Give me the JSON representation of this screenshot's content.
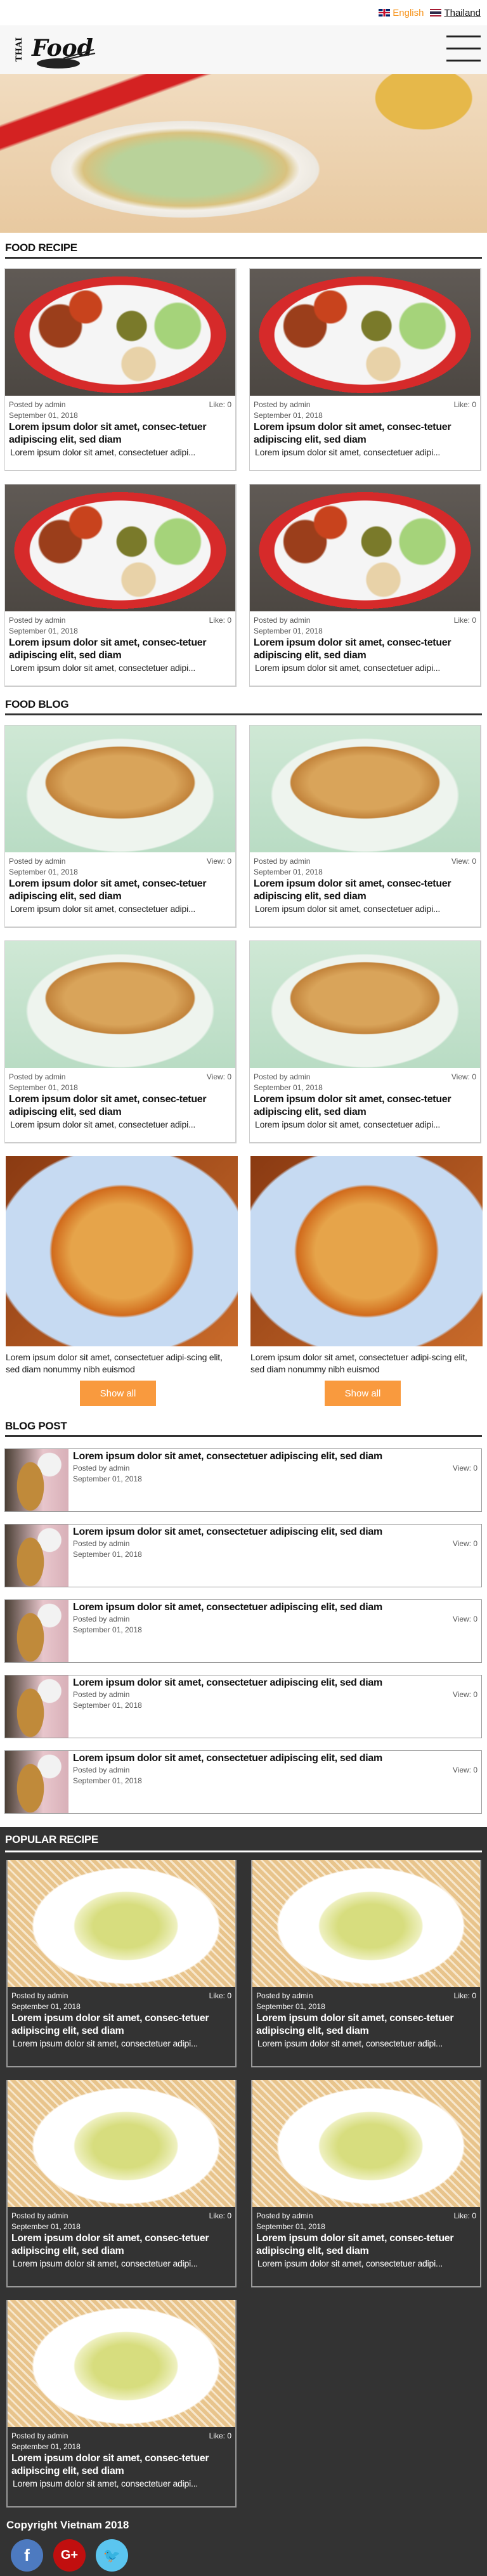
{
  "topbar": {
    "lang_en": "English",
    "lang_th": "Thailand",
    "accent": "#f7941d"
  },
  "header": {
    "logo_text": "Thai Food"
  },
  "sections": {
    "recipe": "FOOD RECIPE",
    "blog": "FOOD BLOG",
    "posts": "BLOG POST",
    "popular": "POPULAR RECIPE"
  },
  "recipes": [
    {
      "author": "Posted by admin",
      "stat": "Like: 0",
      "date": "September 01, 2018",
      "title": "Lorem ipsum dolor sit amet, consec-tetuer adipiscing elit, sed diam",
      "excerpt": "Lorem ipsum dolor sit amet, consectetuer adipi..."
    },
    {
      "author": "Posted by admin",
      "stat": "Like: 0",
      "date": "September 01, 2018",
      "title": "Lorem ipsum dolor sit amet, consec-tetuer adipiscing elit, sed diam",
      "excerpt": "Lorem ipsum dolor sit amet, consectetuer adipi..."
    },
    {
      "author": "Posted by admin",
      "stat": "Like: 0",
      "date": "September 01, 2018",
      "title": "Lorem ipsum dolor sit amet, consec-tetuer adipiscing elit, sed diam",
      "excerpt": "Lorem ipsum dolor sit amet, consectetuer adipi..."
    },
    {
      "author": "Posted by admin",
      "stat": "Like: 0",
      "date": "September 01, 2018",
      "title": "Lorem ipsum dolor sit amet, consec-tetuer adipiscing elit, sed diam",
      "excerpt": "Lorem ipsum dolor sit amet, consectetuer adipi..."
    }
  ],
  "blogs": [
    {
      "author": "Posted by admin",
      "stat": "View: 0",
      "date": "September 01, 2018",
      "title": "Lorem ipsum dolor sit amet, consec-tetuer adipiscing elit, sed diam",
      "excerpt": "Lorem ipsum dolor sit amet, consectetuer adipi..."
    },
    {
      "author": "Posted by admin",
      "stat": "View: 0",
      "date": "September 01, 2018",
      "title": "Lorem ipsum dolor sit amet, consec-tetuer adipiscing elit, sed diam",
      "excerpt": "Lorem ipsum dolor sit amet, consectetuer adipi..."
    },
    {
      "author": "Posted by admin",
      "stat": "View: 0",
      "date": "September 01, 2018",
      "title": "Lorem ipsum dolor sit amet, consec-tetuer adipiscing elit, sed diam",
      "excerpt": "Lorem ipsum dolor sit amet, consectetuer adipi..."
    },
    {
      "author": "Posted by admin",
      "stat": "View: 0",
      "date": "September 01, 2018",
      "title": "Lorem ipsum dolor sit amet, consec-tetuer adipiscing elit, sed diam",
      "excerpt": "Lorem ipsum dolor sit amet, consectetuer adipi..."
    }
  ],
  "features": [
    {
      "text": "Lorem ipsum dolor sit amet, consectetuer adipi-scing elit, sed diam nonummy nibh euismod",
      "button": "Show all"
    },
    {
      "text": "Lorem ipsum dolor sit amet, consectetuer adipi-scing elit, sed diam nonummy nibh euismod",
      "button": "Show all"
    }
  ],
  "posts": [
    {
      "title": "Lorem ipsum dolor sit amet, consectetuer adipiscing elit, sed diam",
      "author": "Posted by admin",
      "stat": "View: 0",
      "date": "September 01, 2018"
    },
    {
      "title": "Lorem ipsum dolor sit amet, consectetuer adipiscing elit, sed diam",
      "author": "Posted by admin",
      "stat": "View: 0",
      "date": "September 01, 2018"
    },
    {
      "title": "Lorem ipsum dolor sit amet, consectetuer adipiscing elit, sed diam",
      "author": "Posted by admin",
      "stat": "View: 0",
      "date": "September 01, 2018"
    },
    {
      "title": "Lorem ipsum dolor sit amet, consectetuer adipiscing elit, sed diam",
      "author": "Posted by admin",
      "stat": "View: 0",
      "date": "September 01, 2018"
    },
    {
      "title": "Lorem ipsum dolor sit amet, consectetuer adipiscing elit, sed diam",
      "author": "Posted by admin",
      "stat": "View: 0",
      "date": "September 01, 2018"
    }
  ],
  "popular": [
    {
      "author": "Posted by admin",
      "stat": "Like: 0",
      "date": "September 01, 2018",
      "title": "Lorem ipsum dolor sit amet, consec-tetuer adipiscing elit, sed diam",
      "excerpt": "Lorem ipsum dolor sit amet, consectetuer adipi..."
    },
    {
      "author": "Posted by admin",
      "stat": "Like: 0",
      "date": "September 01, 2018",
      "title": "Lorem ipsum dolor sit amet, consec-tetuer adipiscing elit, sed diam",
      "excerpt": "Lorem ipsum dolor sit amet, consectetuer adipi..."
    },
    {
      "author": "Posted by admin",
      "stat": "Like: 0",
      "date": "September 01, 2018",
      "title": "Lorem ipsum dolor sit amet, consec-tetuer adipiscing elit, sed diam",
      "excerpt": "Lorem ipsum dolor sit amet, consectetuer adipi..."
    },
    {
      "author": "Posted by admin",
      "stat": "Like: 0",
      "date": "September 01, 2018",
      "title": "Lorem ipsum dolor sit amet, consec-tetuer adipiscing elit, sed diam",
      "excerpt": "Lorem ipsum dolor sit amet, consectetuer adipi..."
    },
    {
      "author": "Posted by admin",
      "stat": "Like: 0",
      "date": "September 01, 2018",
      "title": "Lorem ipsum dolor sit amet, consec-tetuer adipiscing elit, sed diam",
      "excerpt": "Lorem ipsum dolor sit amet, consectetuer adipi..."
    }
  ],
  "footer": {
    "copyright": "Copyright Vietnam 2018",
    "social": [
      {
        "icon": "facebook-icon",
        "glyph": "f"
      },
      {
        "icon": "google-plus-icon",
        "glyph": "G+"
      },
      {
        "icon": "twitter-icon",
        "glyph": "🐦"
      }
    ]
  }
}
